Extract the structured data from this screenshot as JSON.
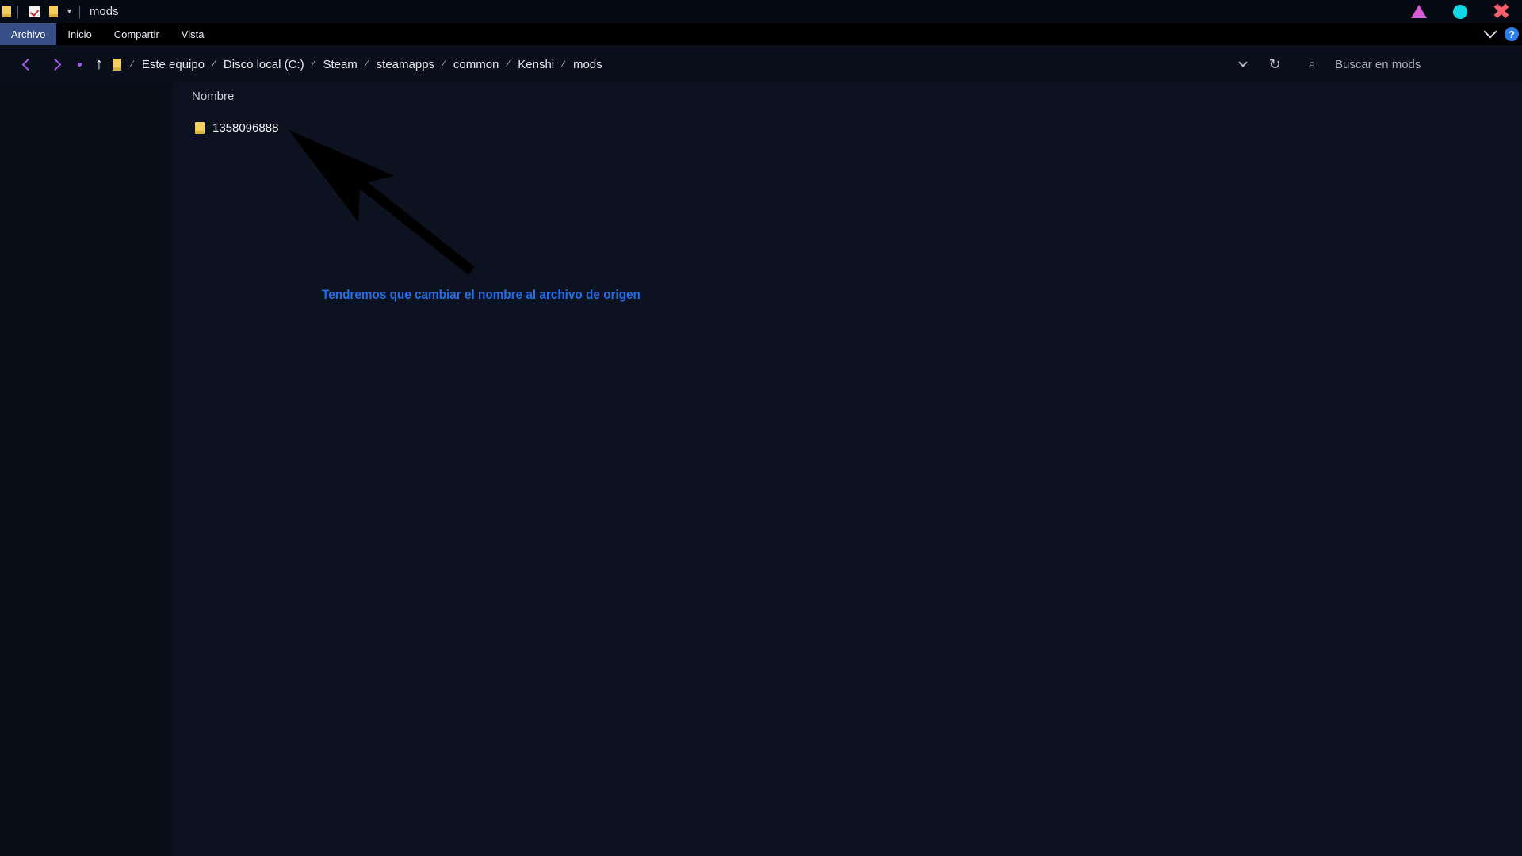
{
  "window": {
    "title": "mods",
    "controls": [
      "triangle-icon",
      "circle-icon",
      "close-icon"
    ],
    "accent_colors": {
      "minimize": "#d45ad6",
      "maximize": "#12d7e5",
      "close": "#ff5c6c"
    }
  },
  "ribbon": {
    "tabs": [
      {
        "label": "Archivo",
        "active": true
      },
      {
        "label": "Inicio",
        "active": false
      },
      {
        "label": "Compartir",
        "active": false
      },
      {
        "label": "Vista",
        "active": false
      }
    ],
    "help_label": "?"
  },
  "address": {
    "breadcrumb": [
      "Este equipo",
      "Disco local (C:)",
      "Steam",
      "steamapps",
      "common",
      "Kenshi",
      "mods"
    ],
    "search_placeholder": "Buscar en mods"
  },
  "main": {
    "column_header": "Nombre",
    "items": [
      {
        "name": "1358096888",
        "type": "folder"
      }
    ]
  },
  "annotation": {
    "text": "Tendremos que cambiar el nombre al archivo de origen",
    "color": "#1f6ee8"
  }
}
